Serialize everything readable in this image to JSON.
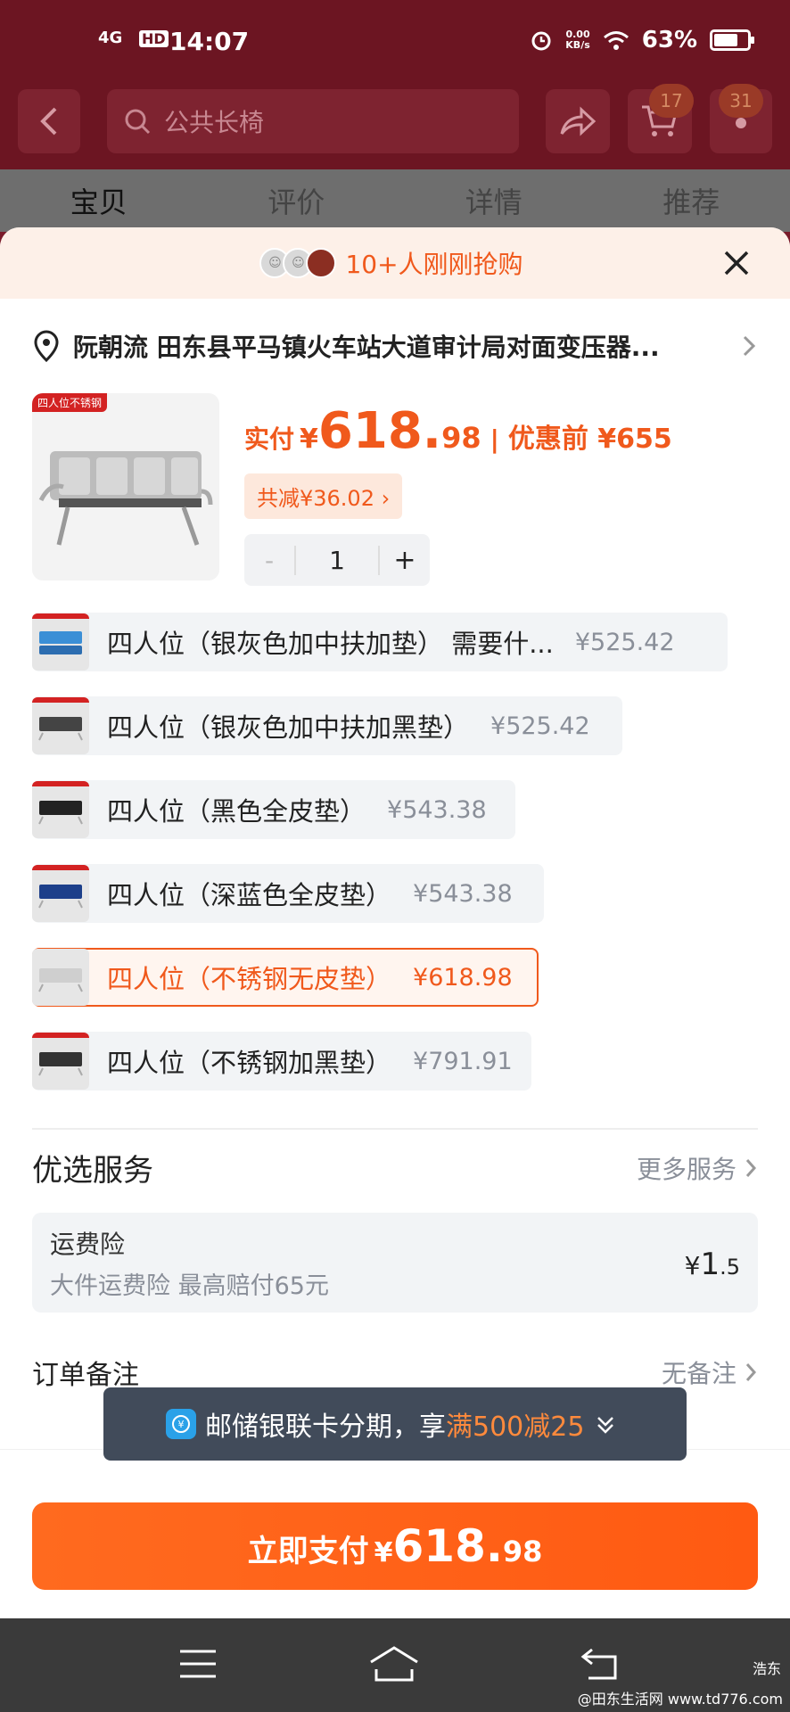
{
  "status_bar": {
    "network": "4G",
    "hd": "HD",
    "time": "14:07",
    "speed_value": "0.00",
    "speed_unit": "KB/s",
    "battery": "63%"
  },
  "header": {
    "search_placeholder": "公共长椅",
    "cart_badge": "17",
    "more_badge": "31"
  },
  "tabs": [
    "宝贝",
    "评价",
    "详情",
    "推荐"
  ],
  "banner": {
    "text": "10+人刚刚抢购"
  },
  "address": {
    "text": "阮朝流 田东县平马镇火车站大道审计局对面变压器..."
  },
  "product": {
    "thumb_tag": "四人位不锈钢",
    "price_label": "实付",
    "yen": "¥",
    "price_int": "618.",
    "price_dec": "98",
    "sep": "|",
    "before_label": "优惠前 ¥655",
    "discount": "共减¥36.02 ›",
    "quantity": "1",
    "minus": "-",
    "plus": "+"
  },
  "variants": [
    {
      "name": "四人位（银灰色加中扶加垫） 需要什...",
      "price": "¥525.42",
      "selected": false
    },
    {
      "name": "四人位（银灰色加中扶加黑垫）",
      "price": "¥525.42",
      "selected": false
    },
    {
      "name": "四人位（黑色全皮垫）",
      "price": "¥543.38",
      "selected": false
    },
    {
      "name": "四人位（深蓝色全皮垫）",
      "price": "¥543.38",
      "selected": false
    },
    {
      "name": "四人位（不锈钢无皮垫）",
      "price": "¥618.98",
      "selected": true
    },
    {
      "name": "四人位（不锈钢加黑垫）",
      "price": "¥791.91",
      "selected": false
    }
  ],
  "services": {
    "title": "优选服务",
    "more": "更多服务",
    "card": {
      "name": "运费险",
      "desc": "大件运费险 最高赔付65元",
      "price_yen": "¥",
      "price_int": "1",
      "price_dec": ".5"
    }
  },
  "note": {
    "label": "订单备注",
    "value": "无备注"
  },
  "toast": {
    "text_prefix": "邮储银联卡分期，享",
    "highlight": "满500减25"
  },
  "pay": {
    "label": "立即支付",
    "yen": "¥",
    "price_int": "618.",
    "price_dec": "98"
  },
  "watermark": {
    "line1": "浩东",
    "line2": "@田东生活网 www.td776.com"
  },
  "colors": {
    "accent": "#f0591c",
    "header_bg": "#6c1522",
    "toast_bg": "#414b5a"
  }
}
